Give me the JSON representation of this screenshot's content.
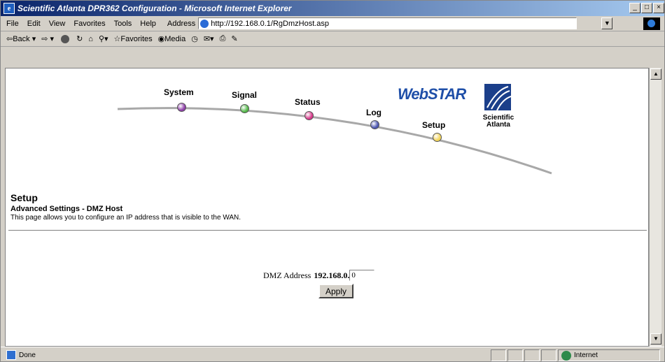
{
  "window": {
    "title": "Scientific Atlanta DPR362 Configuration - Microsoft Internet Explorer"
  },
  "menu": {
    "items": [
      "File",
      "Edit",
      "View",
      "Favorites",
      "Tools",
      "Help"
    ],
    "address_label": "Address",
    "url": "http://192.168.0.1/RgDmzHost.asp"
  },
  "toolbar": {
    "back": "Back",
    "favorites": "Favorites",
    "media": "Media"
  },
  "banner": {
    "nav": [
      "System",
      "Signal",
      "Status",
      "Log",
      "Setup"
    ],
    "brand": "WebSTAR",
    "vendor_line1": "Scientific",
    "vendor_line2": "Atlanta",
    "dot_colors": [
      "#8e3fa8",
      "#54b84a",
      "#d63a8a",
      "#4c56b0",
      "#f2d45a"
    ]
  },
  "page": {
    "title": "Setup",
    "subtitle": "Advanced Settings - DMZ Host",
    "description": "This page allows you to configure an IP address that is visible to the WAN.",
    "dmz_label": "DMZ Address",
    "dmz_prefix": "192.168.0.",
    "dmz_value": "0",
    "apply_label": "Apply"
  },
  "status": {
    "text": "Done",
    "zone": "Internet"
  }
}
